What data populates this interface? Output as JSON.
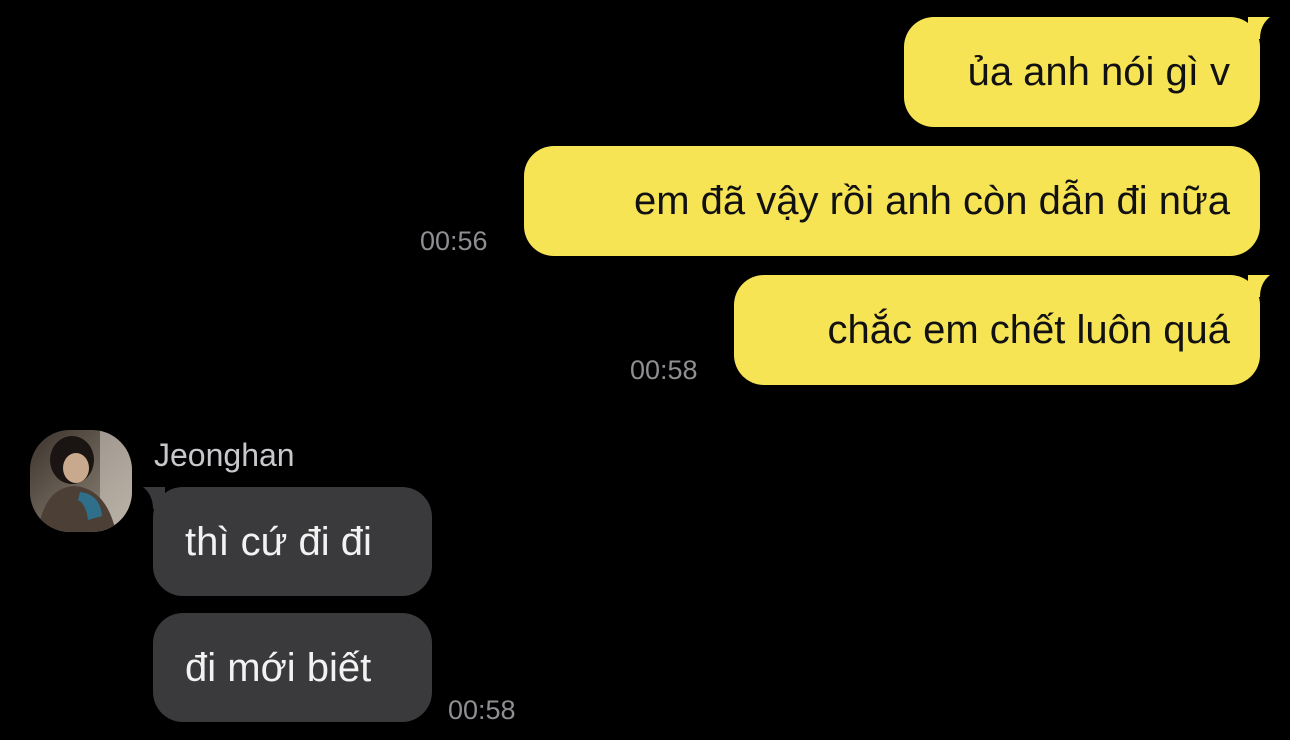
{
  "chat": {
    "messages_out": [
      {
        "text": "ủa anh nói gì v",
        "time": ""
      },
      {
        "text": "em đã vậy rồi anh còn dẫn đi nữa",
        "time": "00:56"
      },
      {
        "text": "chắc em chết luôn quá",
        "time": "00:58"
      }
    ],
    "incoming": {
      "sender": "Jeonghan",
      "avatar_icon": "profile-photo",
      "messages": [
        {
          "text": "thì cứ đi đi",
          "time": ""
        },
        {
          "text": "đi mới biết",
          "time": "00:58"
        }
      ]
    }
  },
  "colors": {
    "background": "#000000",
    "outgoing_bubble": "#f7e455",
    "incoming_bubble": "#3a3a3c",
    "timestamp": "#8e8e93"
  }
}
